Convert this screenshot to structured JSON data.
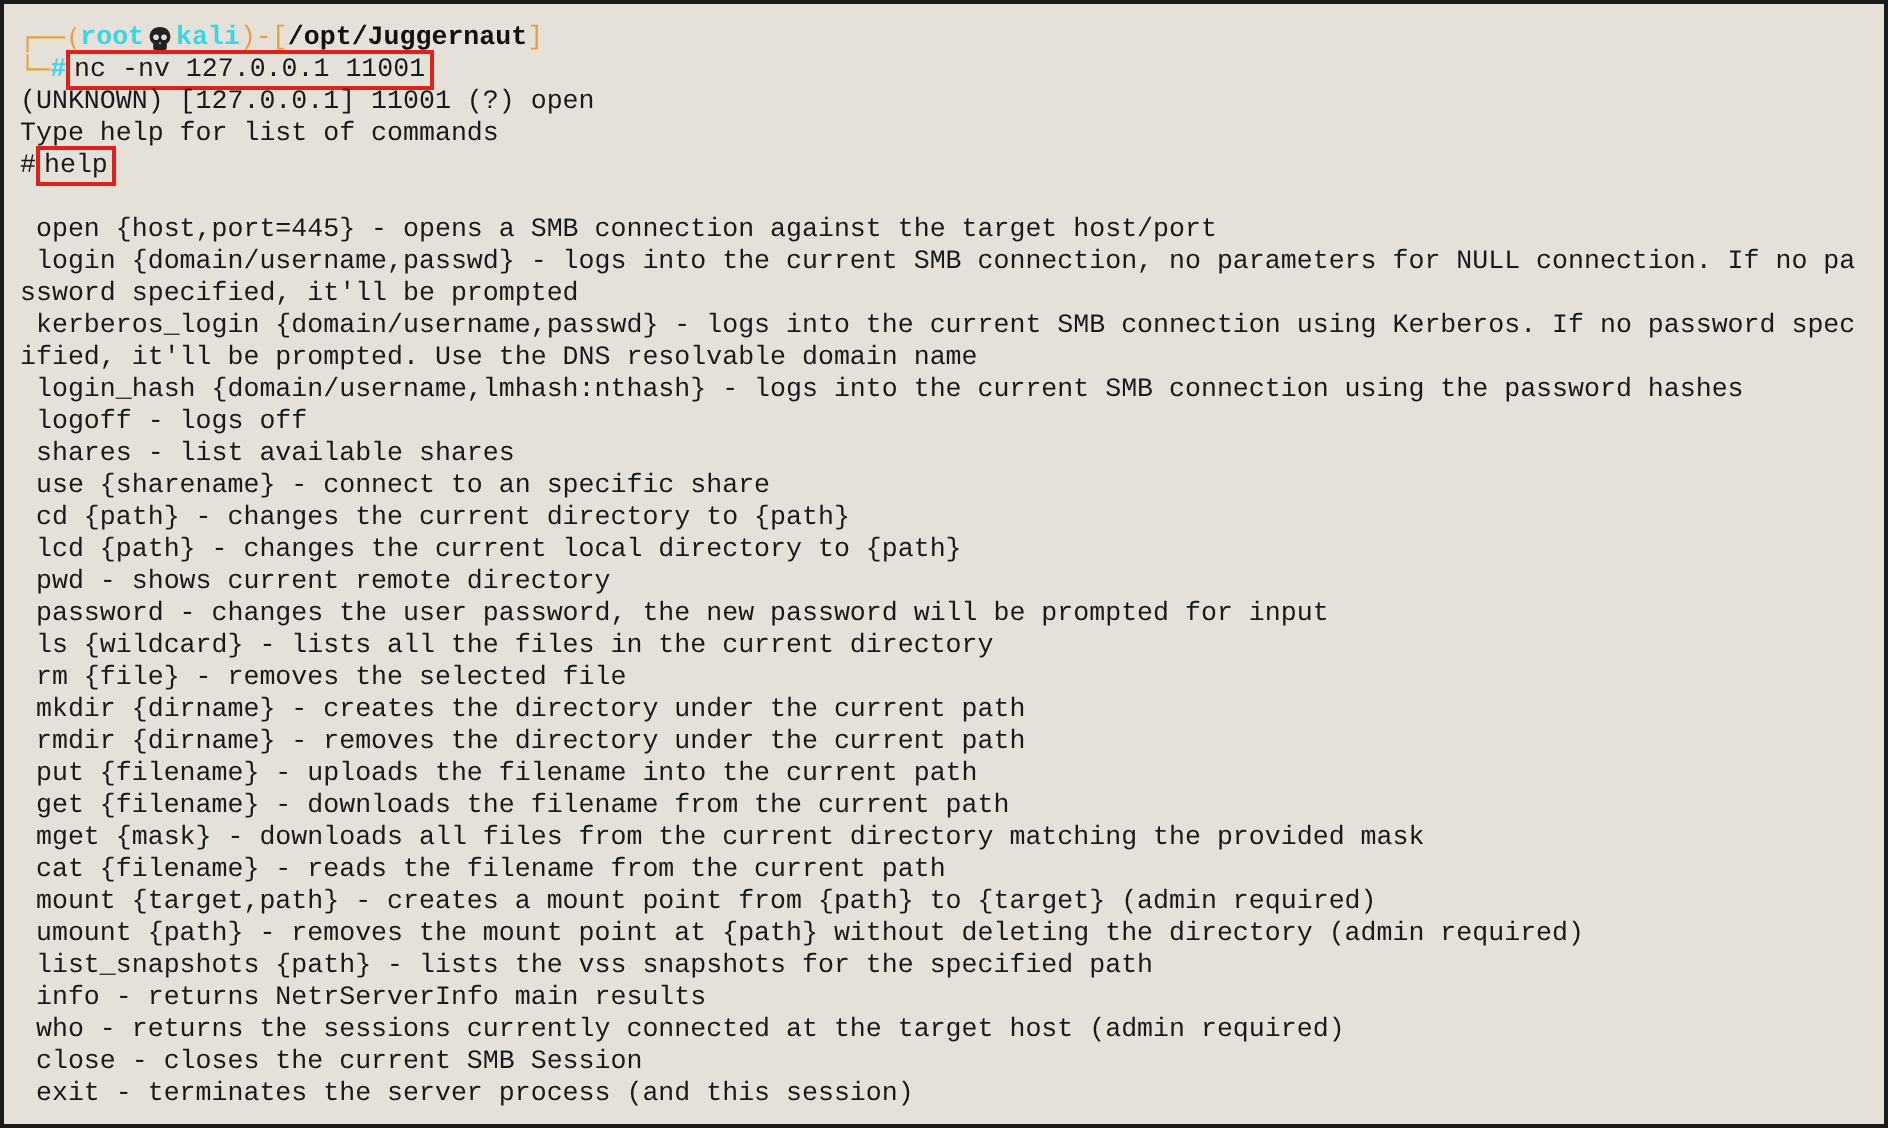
{
  "prompt": {
    "corner_top": "┌──(",
    "user": "root",
    "host": "kali",
    "separator": ")-[",
    "path": "/opt/Juggernaut",
    "close": "]",
    "corner_bottom": "└─",
    "symbol": "#",
    "command": "nc -nv 127.0.0.1 11001",
    "highlighted": true
  },
  "output": [
    "(UNKNOWN) [127.0.0.1] 11001 (?) open",
    "Type help for list of commands"
  ],
  "shell": {
    "symbol": "#",
    "command": "help",
    "highlighted": true
  },
  "help_lines": [
    " open {host,port=445} - opens a SMB connection against the target host/port",
    " login {domain/username,passwd} - logs into the current SMB connection, no parameters for NULL connection. If no pa",
    "ssword specified, it'll be prompted",
    " kerberos_login {domain/username,passwd} - logs into the current SMB connection using Kerberos. If no password spec",
    "ified, it'll be prompted. Use the DNS resolvable domain name",
    " login_hash {domain/username,lmhash:nthash} - logs into the current SMB connection using the password hashes",
    " logoff - logs off",
    " shares - list available shares",
    " use {sharename} - connect to an specific share",
    " cd {path} - changes the current directory to {path}",
    " lcd {path} - changes the current local directory to {path}",
    " pwd - shows current remote directory",
    " password - changes the user password, the new password will be prompted for input",
    " ls {wildcard} - lists all the files in the current directory",
    " rm {file} - removes the selected file",
    " mkdir {dirname} - creates the directory under the current path",
    " rmdir {dirname} - removes the directory under the current path",
    " put {filename} - uploads the filename into the current path",
    " get {filename} - downloads the filename from the current path",
    " mget {mask} - downloads all files from the current directory matching the provided mask",
    " cat {filename} - reads the filename from the current path",
    " mount {target,path} - creates a mount point from {path} to {target} (admin required)",
    " umount {path} - removes the mount point at {path} without deleting the directory (admin required)",
    " list_snapshots {path} - lists the vss snapshots for the specified path",
    " info - returns NetrServerInfo main results",
    " who - returns the sessions currently connected at the target host (admin required)",
    " close - closes the current SMB Session",
    " exit - terminates the server process (and this session)"
  ]
}
